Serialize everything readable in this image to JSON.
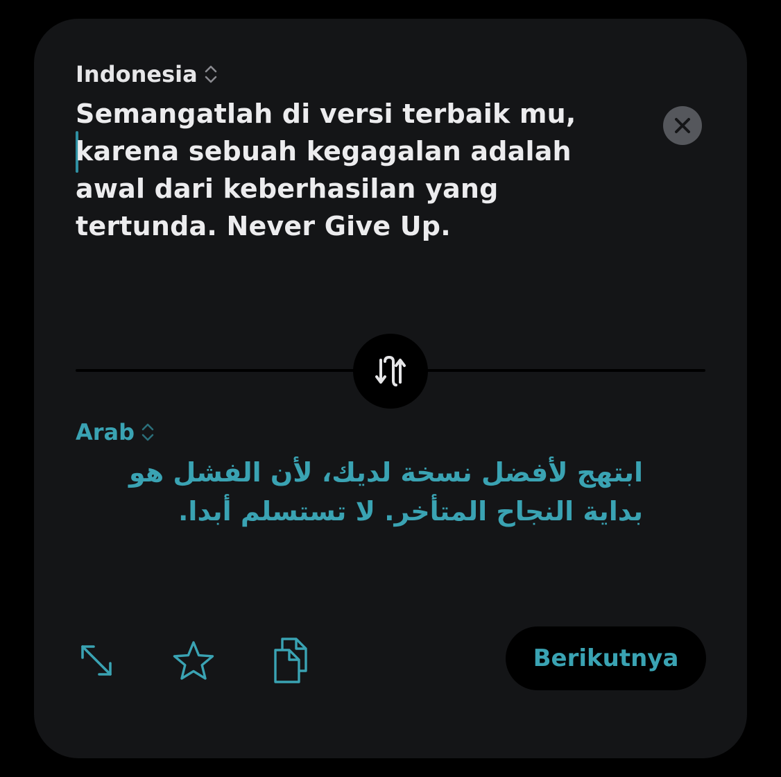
{
  "source": {
    "language": "Indonesia",
    "text": "Semangatlah di versi terbaik mu, karena sebuah kegagalan adalah awal dari keberhasilan yang tertunda. Never Give Up."
  },
  "target": {
    "language": "Arab",
    "text": "ابتهج لأفضل نسخة لديك، لأن الفشل هو بداية النجاح المتأخر. لا تستسلم أبدا."
  },
  "actions": {
    "next_label": "Berikutnya"
  },
  "icons": {
    "clear": "close-icon",
    "swap": "swap-arrows-icon",
    "expand": "expand-icon",
    "favorite": "star-icon",
    "copy": "copy-icon"
  },
  "colors": {
    "accent": "#3aa3b3",
    "card": "#141517",
    "source_text": "#ececee"
  }
}
